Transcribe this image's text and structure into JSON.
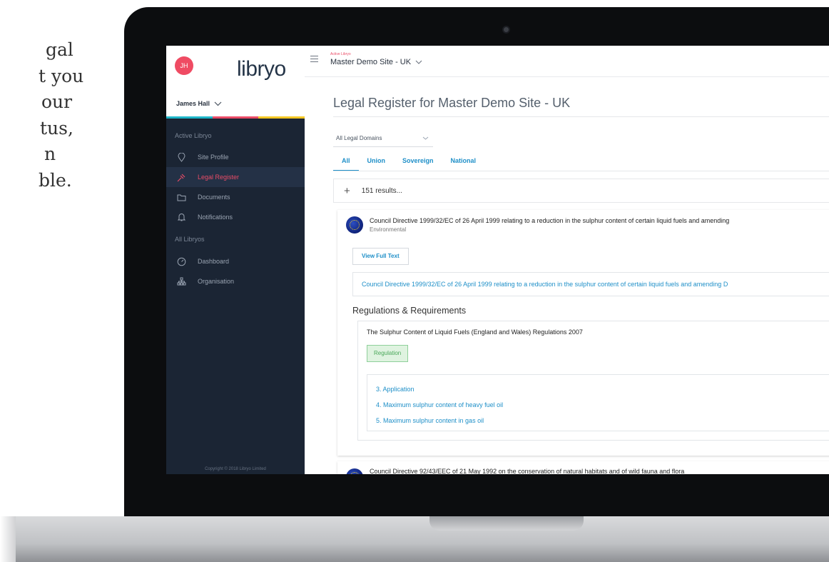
{
  "marketing": {
    "lines": [
      "gal",
      "t you",
      "our",
      "tus,",
      "n",
      "ble."
    ]
  },
  "app": {
    "avatar_initials": "JH",
    "logo": "libryo",
    "user_name": "James Hall",
    "brand_colors": [
      "#1fb6c9",
      "#ea4c67",
      "#f3c623"
    ],
    "nav": {
      "section_active": "Active Libryo",
      "site_profile": "Site Profile",
      "legal_register": "Legal Register",
      "documents": "Documents",
      "notifications": "Notifications",
      "section_all": "All Libryos",
      "dashboard": "Dashboard",
      "organisation": "Organisation"
    },
    "copyright": "Copyright © 2018 Libryo Limited"
  },
  "topbar": {
    "active_label": "Active Libryo",
    "site_name": "Master Demo Site - UK"
  },
  "main": {
    "page_title": "Legal Register for Master Demo Site - UK",
    "domain_select": "All Legal Domains",
    "tabs": [
      "All",
      "Union",
      "Sovereign",
      "National"
    ],
    "results": "151 results...",
    "card1": {
      "title": "Council Directive 1999/32/EC of 26 April 1999 relating to a reduction in the sulphur content of certain liquid fuels and amending",
      "subtitle": "Environmental",
      "view_full_text": "View Full Text",
      "link_text": "Council Directive 1999/32/EC of 26 April 1999 relating to a reduction in the sulphur content of certain liquid fuels and amending D",
      "regulations_heading": "Regulations & Requirements",
      "regulation_title": "The Sulphur Content of Liquid Fuels (England and Wales) Regulations 2007",
      "badge": "Regulation",
      "sections": [
        "3. Application",
        "4. Maximum sulphur content of heavy fuel oil",
        "5. Maximum sulphur content in gas oil"
      ]
    },
    "card2": {
      "title": "Council Directive 92/43/EEC of 21 May 1992 on the conservation of natural habitats and of wild fauna and flora"
    }
  }
}
